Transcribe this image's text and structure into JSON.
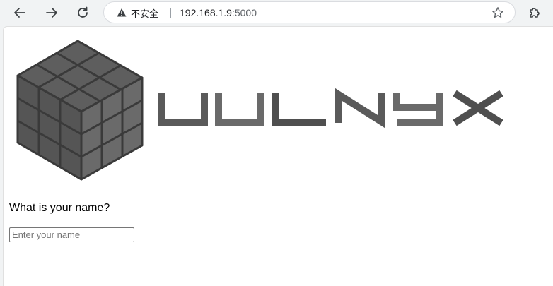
{
  "browser": {
    "security_label": "不安全",
    "url_host": "192.168.1.9",
    "url_port": ":5000"
  },
  "page": {
    "logo_text": "VULNYX",
    "question": "What is your name?",
    "name_placeholder": "Enter your name",
    "name_value": ""
  },
  "icons": {
    "back": "arrow-left-icon",
    "forward": "arrow-right-icon",
    "reload": "reload-icon",
    "warning": "warning-icon",
    "bookmark": "star-icon",
    "extensions": "puzzle-icon"
  },
  "colors": {
    "cube_dark": "#4a4a4a",
    "cube_face": "#686868",
    "logo_text": "#5a5a5a"
  }
}
